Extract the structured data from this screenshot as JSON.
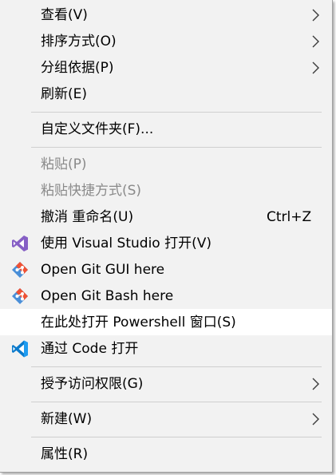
{
  "menu": {
    "items": [
      {
        "label": "查看(V)",
        "submenu": true
      },
      {
        "label": "排序方式(O)",
        "submenu": true
      },
      {
        "label": "分组依据(P)",
        "submenu": true
      },
      {
        "label": "刷新(E)"
      },
      {
        "label": "自定义文件夹(F)..."
      },
      {
        "label": "粘贴(P)",
        "disabled": true
      },
      {
        "label": "粘贴快捷方式(S)",
        "disabled": true
      },
      {
        "label": "撤消 重命名(U)",
        "shortcut": "Ctrl+Z"
      },
      {
        "label": "使用 Visual Studio 打开(V)",
        "icon": "visual-studio-icon"
      },
      {
        "label": "Open Git GUI here",
        "icon": "git-gui-icon"
      },
      {
        "label": "Open Git Bash here",
        "icon": "git-bash-icon"
      },
      {
        "label": "在此处打开 Powershell 窗口(S)",
        "highlighted": true
      },
      {
        "label": "通过 Code 打开",
        "icon": "vscode-icon"
      },
      {
        "label": "授予访问权限(G)",
        "submenu": true
      },
      {
        "label": "新建(W)",
        "submenu": true
      },
      {
        "label": "属性(R)"
      }
    ]
  },
  "colors": {
    "menu_background": "#f2f2f2",
    "hover_background": "#ffffff",
    "disabled_text": "#8a8a8a",
    "visual_studio_purple": "#865fc5",
    "git_orange": "#f05133",
    "git_blue": "#4a8fd8",
    "vscode_blue": "#0a7acc"
  }
}
